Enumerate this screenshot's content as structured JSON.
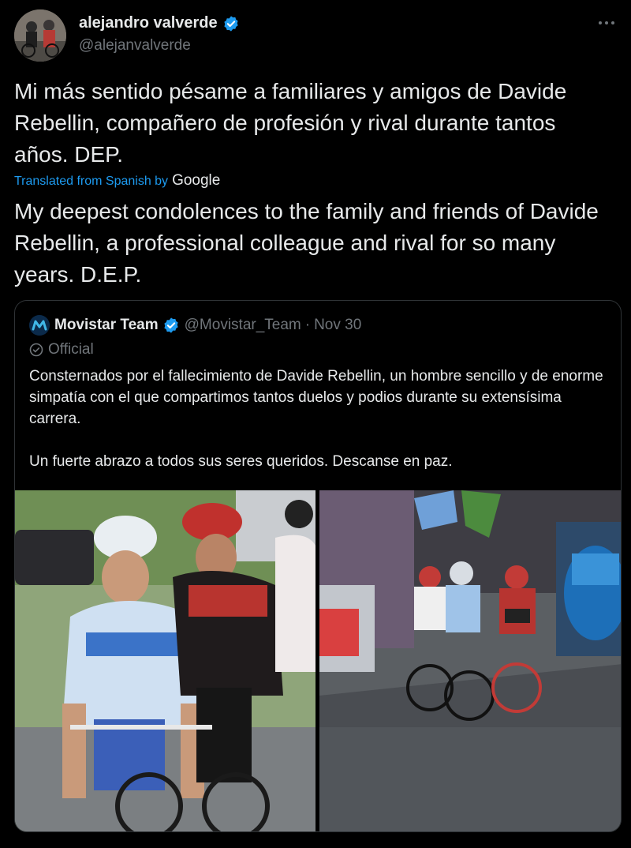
{
  "author": {
    "display_name": "alejandro valverde",
    "handle": "@alejanvalverde",
    "verified": true
  },
  "tweet": {
    "original_text": "Mi más sentido pésame a familiares y amigos de Davide Rebellin, compañero de profesión y rival durante tantos años. DEP.",
    "translated_label": "Translated from Spanish by",
    "translator": "Google",
    "translation_text": "My deepest condolences to the family and friends of Davide Rebellin, a professional colleague and rival for so many years. D.E.P."
  },
  "quoted_tweet": {
    "display_name": "Movistar Team",
    "handle": "@Movistar_Team",
    "separator": "·",
    "date": "Nov 30",
    "label": "Official",
    "paragraph_1": "Consternados por el fallecimiento de Davide Rebellin, un hombre sencillo y de enorme simpatía con el que compartimos tantos duelos y podios durante su extensísima carrera.",
    "paragraph_2": "Un fuerte abrazo a todos sus seres queridos. Descanse en paz.",
    "media": [
      {
        "name": "cyclists-closeup-photo"
      },
      {
        "name": "cyclists-group-photo"
      }
    ]
  },
  "colors": {
    "background": "#000000",
    "text": "#e7e9ea",
    "secondary": "#71767b",
    "accent": "#1d9bf0",
    "border": "#2f3336"
  }
}
